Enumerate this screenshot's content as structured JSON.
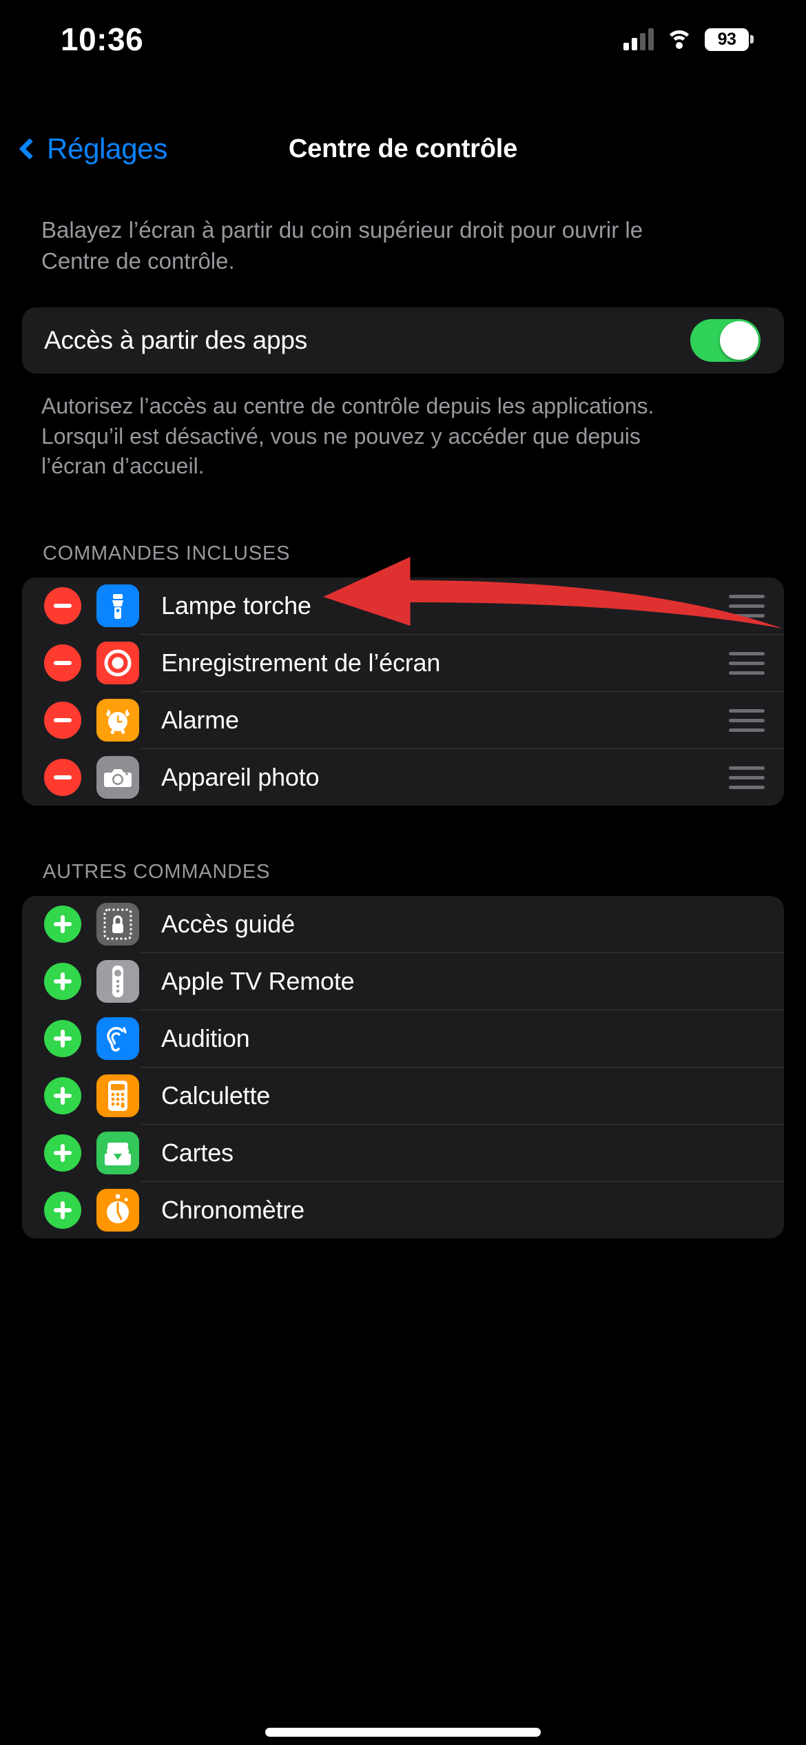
{
  "status_bar": {
    "time": "10:36",
    "battery_percent": "93",
    "signal_icon": "cellular-signal-icon",
    "wifi_icon": "wifi-icon",
    "battery_icon": "battery-icon",
    "signal_bars_filled": 2,
    "signal_bars_total": 4
  },
  "nav": {
    "back_label": "Réglages",
    "back_icon": "chevron-left-icon",
    "title": "Centre de contrôle"
  },
  "intro": {
    "text": "Balayez l’écran à partir du coin supérieur droit pour ouvrir le Centre de contrôle."
  },
  "access_setting": {
    "label": "Accès à partir des apps",
    "enabled": true,
    "footnote": "Autorisez l’accès au centre de contrôle depuis les applications. Lorsqu’il est désactivé, vous ne pouvez y accéder que depuis l’écran d’accueil."
  },
  "included": {
    "header": "COMMANDES INCLUSES",
    "items": [
      {
        "label": "Lampe torche",
        "icon": "flashlight-icon",
        "icon_bg": "#0A84FF",
        "action": "remove",
        "action_icon": "minus-circle-icon",
        "handle_icon": "reorder-handle-icon"
      },
      {
        "label": "Enregistrement de l’écran",
        "icon": "screen-record-icon",
        "icon_bg": "#FF3B30",
        "action": "remove",
        "action_icon": "minus-circle-icon",
        "handle_icon": "reorder-handle-icon"
      },
      {
        "label": "Alarme",
        "icon": "alarm-clock-icon",
        "icon_bg": "#FF9F0A",
        "action": "remove",
        "action_icon": "minus-circle-icon",
        "handle_icon": "reorder-handle-icon"
      },
      {
        "label": "Appareil photo",
        "icon": "camera-icon",
        "icon_bg": "#8E8E93",
        "action": "remove",
        "action_icon": "minus-circle-icon",
        "handle_icon": "reorder-handle-icon"
      }
    ]
  },
  "others": {
    "header": "AUTRES COMMANDES",
    "items": [
      {
        "label": "Accès guidé",
        "icon": "guided-access-lock-icon",
        "icon_bg": "#636366",
        "action": "add",
        "action_icon": "plus-circle-icon"
      },
      {
        "label": "Apple TV Remote",
        "icon": "tv-remote-icon",
        "icon_bg": "#9E9EA3",
        "action": "add",
        "action_icon": "plus-circle-icon"
      },
      {
        "label": "Audition",
        "icon": "hearing-ear-icon",
        "icon_bg": "#0A84FF",
        "action": "add",
        "action_icon": "plus-circle-icon"
      },
      {
        "label": "Calculette",
        "icon": "calculator-icon",
        "icon_bg": "#FF9500",
        "action": "add",
        "action_icon": "plus-circle-icon"
      },
      {
        "label": "Cartes",
        "icon": "wallet-cards-icon",
        "icon_bg": "#34C759",
        "action": "add",
        "action_icon": "plus-circle-icon"
      },
      {
        "label": "Chronomètre",
        "icon": "stopwatch-icon",
        "icon_bg": "#FF9500",
        "action": "add",
        "action_icon": "plus-circle-icon"
      }
    ]
  },
  "annotation": {
    "type": "arrow",
    "color": "#E03131",
    "points_at": "Alarme row reorder handle"
  },
  "colors": {
    "background": "#000000",
    "card": "#1C1C1E",
    "separator": "#38383A",
    "secondary_text": "#98989E",
    "accent_blue": "#0A84FF",
    "toggle_on_green": "#30D158",
    "remove_red": "#FF3B30",
    "add_green": "#32D74B"
  },
  "home_indicator": {
    "visible": true
  }
}
